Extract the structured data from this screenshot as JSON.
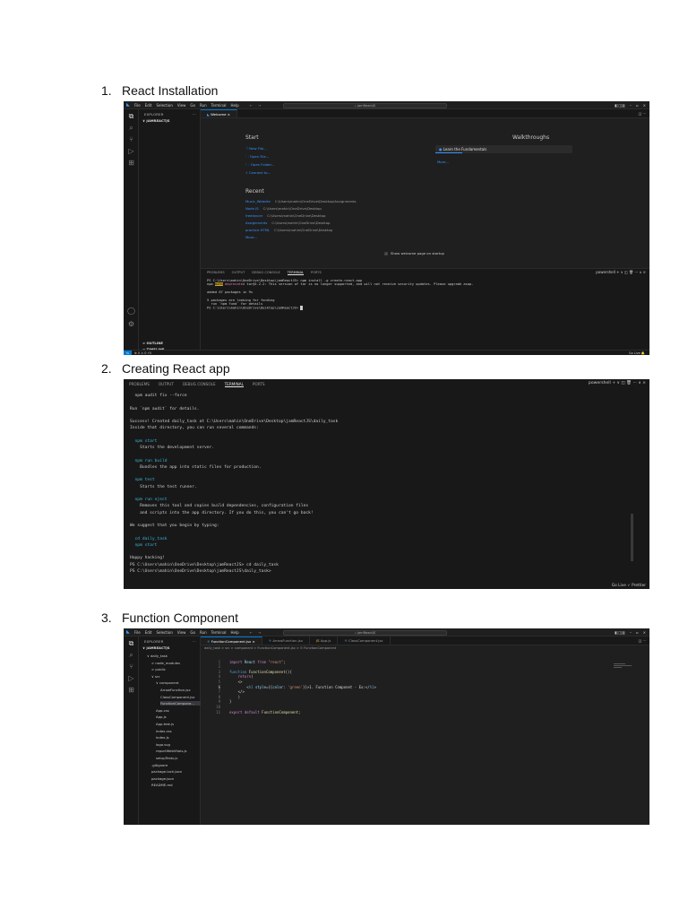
{
  "headings": [
    {
      "num": "1.",
      "text": "React Installation"
    },
    {
      "num": "2.",
      "text": "Creating React app"
    },
    {
      "num": "3.",
      "text": "Function Component"
    }
  ],
  "vscode": {
    "menu": [
      "File",
      "Edit",
      "Selection",
      "View",
      "Go",
      "Run",
      "Terminal",
      "Help"
    ],
    "search_text": "jamReactJS",
    "explorer_label": "EXPLORER",
    "explorer_more": "···"
  },
  "shot1": {
    "root_folder": "JAMREACTJS",
    "tab": "Welcome",
    "start_title": "Start",
    "start_items": [
      "New File...",
      "Open File...",
      "Open Folder...",
      "Connect to..."
    ],
    "recent_title": "Recent",
    "recent": [
      {
        "name": "Music_Website",
        "path": "C:\\Users\\mahin\\OneDrive\\Desktop\\Assignments"
      },
      {
        "name": "Node JS",
        "path": "C:\\Users\\mahin\\OneDrive\\Desktop"
      },
      {
        "name": "freelancer",
        "path": "C:\\Users\\mahin\\OneDrive\\Desktop"
      },
      {
        "name": "Assignments",
        "path": "C:\\Users\\mahin\\OneDrive\\Desktop"
      },
      {
        "name": "practice HTML",
        "path": "C:\\Users\\mahin\\OneDrive\\Desktop"
      }
    ],
    "recent_more": "More...",
    "walkthroughs_title": "Walkthroughs",
    "walkthrough_item": "Learn the Fundamentals",
    "walkthrough_more": "More...",
    "show_welcome": "Show welcome page on startup",
    "panel_tabs": [
      "PROBLEMS",
      "OUTPUT",
      "DEBUG CONSOLE",
      "TERMINAL",
      "PORTS"
    ],
    "panel_right": "powershell  + ∨  ◫  🗑  ···  ∧  ×",
    "terminal": [
      "PS C:\\Users\\mahin\\OneDrive\\Desktop\\jamReactJS> npm install -g create-react-app",
      "npm WARN deprecated tar@2.2.2: This version of tar is no longer supported, and will not receive security updates. Please upgrade asap.",
      "",
      "added 67 packages in 9s",
      "",
      "5 packages are looking for funding",
      "  run `npm fund` for details",
      "PS C:\\Users\\mahin\\OneDrive\\Desktop\\jamReactJS>"
    ],
    "outline": "OUTLINE",
    "timeline": "TIMELINE",
    "status_left": "⊗ 0 ⚠ 0   ⚡0",
    "status_right": "Go Live"
  },
  "shot2": {
    "panel_tabs": [
      "PROBLEMS",
      "OUTPUT",
      "DEBUG CONSOLE",
      "TERMINAL",
      "PORTS"
    ],
    "panel_right": "powershell  + ∨  ◫  🗑  ···  ∧  ×",
    "lines": [
      {
        "t": "  npm audit fix --force",
        "c": ""
      },
      {
        "t": "",
        "c": ""
      },
      {
        "t": "Run `npm audit` for details.",
        "c": ""
      },
      {
        "t": "",
        "c": ""
      },
      {
        "t": "Success! Created daily_task at C:\\Users\\mahin\\OneDrive\\Desktop\\jamReactJS\\daily_task",
        "c": ""
      },
      {
        "t": "Inside that directory, you can run several commands:",
        "c": ""
      },
      {
        "t": "",
        "c": ""
      },
      {
        "t": "  npm start",
        "c": "cy"
      },
      {
        "t": "    Starts the development server.",
        "c": ""
      },
      {
        "t": "",
        "c": ""
      },
      {
        "t": "  npm run build",
        "c": "cy"
      },
      {
        "t": "    Bundles the app into static files for production.",
        "c": ""
      },
      {
        "t": "",
        "c": ""
      },
      {
        "t": "  npm test",
        "c": "cy"
      },
      {
        "t": "    Starts the test runner.",
        "c": ""
      },
      {
        "t": "",
        "c": ""
      },
      {
        "t": "  npm run eject",
        "c": "cy"
      },
      {
        "t": "    Removes this tool and copies build dependencies, configuration files",
        "c": ""
      },
      {
        "t": "    and scripts into the app directory. If you do this, you can't go back!",
        "c": ""
      },
      {
        "t": "",
        "c": ""
      },
      {
        "t": "We suggest that you begin by typing:",
        "c": ""
      },
      {
        "t": "",
        "c": ""
      },
      {
        "t": "  cd daily_task",
        "c": "cy"
      },
      {
        "t": "  npm start",
        "c": "cy"
      },
      {
        "t": "",
        "c": ""
      },
      {
        "t": "Happy hacking!",
        "c": ""
      },
      {
        "t": "PS C:\\Users\\mahin\\OneDrive\\Desktop\\jamReactJS> cd daily_task",
        "c": ""
      },
      {
        "t": "PS C:\\Users\\mahin\\OneDrive\\Desktop\\jamReactJS\\daily_task>",
        "c": ""
      }
    ],
    "status": "Go Live   ✓ Prettier"
  },
  "shot3": {
    "root_folder": "JAMREACTJS",
    "tabs": [
      "FunctionComponent.jsx",
      "ArrowFunction.jsx",
      "App.js",
      "ClassComponent.jsx"
    ],
    "breadcrumb": "daily_task > src > component > FunctionComponent.jsx > ⊙ FunctionComponent",
    "tree": [
      {
        "label": "∨ daily_task",
        "indent": 1
      },
      {
        "label": "> node_modules",
        "indent": 2
      },
      {
        "label": "> public",
        "indent": 2
      },
      {
        "label": "∨ src",
        "indent": 2
      },
      {
        "label": "∨ component",
        "indent": 3
      },
      {
        "label": "ArrowFunction.jsx",
        "indent": 4
      },
      {
        "label": "ClassComponent.jsx",
        "indent": 4
      },
      {
        "label": "FunctionCompone...",
        "indent": 4
      },
      {
        "label": "App.css",
        "indent": 3
      },
      {
        "label": "App.js",
        "indent": 3
      },
      {
        "label": "App.test.js",
        "indent": 3
      },
      {
        "label": "index.css",
        "indent": 3
      },
      {
        "label": "index.js",
        "indent": 3
      },
      {
        "label": "logo.svg",
        "indent": 3
      },
      {
        "label": "reportWebVitals.js",
        "indent": 3
      },
      {
        "label": "setupTests.js",
        "indent": 3
      },
      {
        "label": ".gitignore",
        "indent": 2
      },
      {
        "label": "package-lock.json",
        "indent": 2
      },
      {
        "label": "package.json",
        "indent": 2
      },
      {
        "label": "README.md",
        "indent": 2
      }
    ],
    "code_lines": [
      "1",
      "2",
      "3",
      "4",
      "5",
      "6",
      "7",
      "8",
      "9",
      "10",
      "11"
    ]
  }
}
